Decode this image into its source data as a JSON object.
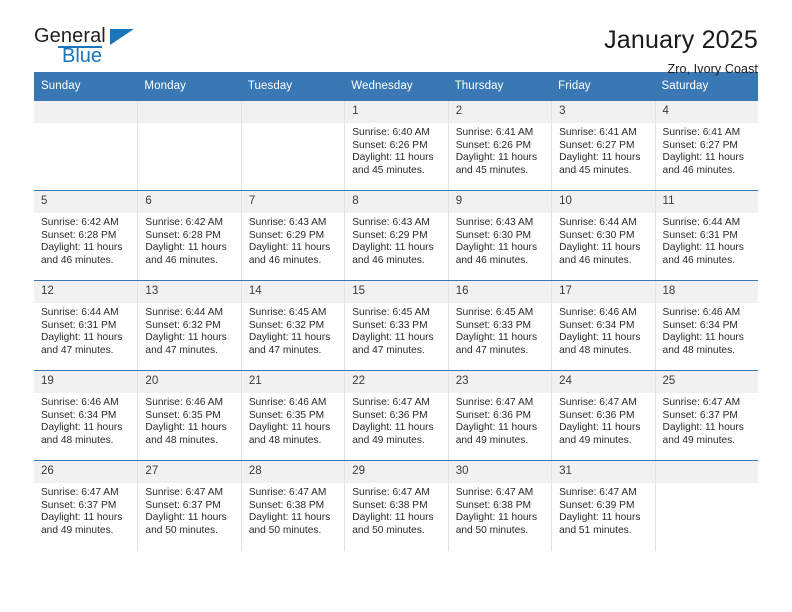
{
  "brand": {
    "name_top": "General",
    "name_bottom": "Blue",
    "accent_color": "#1b75bb"
  },
  "header": {
    "title": "January 2025",
    "subtitle": "Zro, Ivory Coast"
  },
  "theme": {
    "header_row_bg": "#3a78b5",
    "daynum_bg": "#f1f1f1",
    "cell_bg": "#ffffff",
    "text_color": "#2a2a2a"
  },
  "weekdays": [
    "Sunday",
    "Monday",
    "Tuesday",
    "Wednesday",
    "Thursday",
    "Friday",
    "Saturday"
  ],
  "labels": {
    "sunrise_prefix": "Sunrise:",
    "sunset_prefix": "Sunset:",
    "daylight_prefix": "Daylight:"
  },
  "weeks": [
    [
      {
        "day": "",
        "sunrise": "",
        "sunset": "",
        "daylight_1": "",
        "daylight_2": "",
        "empty": true
      },
      {
        "day": "",
        "sunrise": "",
        "sunset": "",
        "daylight_1": "",
        "daylight_2": "",
        "empty": true
      },
      {
        "day": "",
        "sunrise": "",
        "sunset": "",
        "daylight_1": "",
        "daylight_2": "",
        "empty": true
      },
      {
        "day": "1",
        "sunrise": "Sunrise: 6:40 AM",
        "sunset": "Sunset: 6:26 PM",
        "daylight_1": "Daylight: 11 hours",
        "daylight_2": "and 45 minutes."
      },
      {
        "day": "2",
        "sunrise": "Sunrise: 6:41 AM",
        "sunset": "Sunset: 6:26 PM",
        "daylight_1": "Daylight: 11 hours",
        "daylight_2": "and 45 minutes."
      },
      {
        "day": "3",
        "sunrise": "Sunrise: 6:41 AM",
        "sunset": "Sunset: 6:27 PM",
        "daylight_1": "Daylight: 11 hours",
        "daylight_2": "and 45 minutes."
      },
      {
        "day": "4",
        "sunrise": "Sunrise: 6:41 AM",
        "sunset": "Sunset: 6:27 PM",
        "daylight_1": "Daylight: 11 hours",
        "daylight_2": "and 46 minutes."
      }
    ],
    [
      {
        "day": "5",
        "sunrise": "Sunrise: 6:42 AM",
        "sunset": "Sunset: 6:28 PM",
        "daylight_1": "Daylight: 11 hours",
        "daylight_2": "and 46 minutes."
      },
      {
        "day": "6",
        "sunrise": "Sunrise: 6:42 AM",
        "sunset": "Sunset: 6:28 PM",
        "daylight_1": "Daylight: 11 hours",
        "daylight_2": "and 46 minutes."
      },
      {
        "day": "7",
        "sunrise": "Sunrise: 6:43 AM",
        "sunset": "Sunset: 6:29 PM",
        "daylight_1": "Daylight: 11 hours",
        "daylight_2": "and 46 minutes."
      },
      {
        "day": "8",
        "sunrise": "Sunrise: 6:43 AM",
        "sunset": "Sunset: 6:29 PM",
        "daylight_1": "Daylight: 11 hours",
        "daylight_2": "and 46 minutes."
      },
      {
        "day": "9",
        "sunrise": "Sunrise: 6:43 AM",
        "sunset": "Sunset: 6:30 PM",
        "daylight_1": "Daylight: 11 hours",
        "daylight_2": "and 46 minutes."
      },
      {
        "day": "10",
        "sunrise": "Sunrise: 6:44 AM",
        "sunset": "Sunset: 6:30 PM",
        "daylight_1": "Daylight: 11 hours",
        "daylight_2": "and 46 minutes."
      },
      {
        "day": "11",
        "sunrise": "Sunrise: 6:44 AM",
        "sunset": "Sunset: 6:31 PM",
        "daylight_1": "Daylight: 11 hours",
        "daylight_2": "and 46 minutes."
      }
    ],
    [
      {
        "day": "12",
        "sunrise": "Sunrise: 6:44 AM",
        "sunset": "Sunset: 6:31 PM",
        "daylight_1": "Daylight: 11 hours",
        "daylight_2": "and 47 minutes."
      },
      {
        "day": "13",
        "sunrise": "Sunrise: 6:44 AM",
        "sunset": "Sunset: 6:32 PM",
        "daylight_1": "Daylight: 11 hours",
        "daylight_2": "and 47 minutes."
      },
      {
        "day": "14",
        "sunrise": "Sunrise: 6:45 AM",
        "sunset": "Sunset: 6:32 PM",
        "daylight_1": "Daylight: 11 hours",
        "daylight_2": "and 47 minutes."
      },
      {
        "day": "15",
        "sunrise": "Sunrise: 6:45 AM",
        "sunset": "Sunset: 6:33 PM",
        "daylight_1": "Daylight: 11 hours",
        "daylight_2": "and 47 minutes."
      },
      {
        "day": "16",
        "sunrise": "Sunrise: 6:45 AM",
        "sunset": "Sunset: 6:33 PM",
        "daylight_1": "Daylight: 11 hours",
        "daylight_2": "and 47 minutes."
      },
      {
        "day": "17",
        "sunrise": "Sunrise: 6:46 AM",
        "sunset": "Sunset: 6:34 PM",
        "daylight_1": "Daylight: 11 hours",
        "daylight_2": "and 48 minutes."
      },
      {
        "day": "18",
        "sunrise": "Sunrise: 6:46 AM",
        "sunset": "Sunset: 6:34 PM",
        "daylight_1": "Daylight: 11 hours",
        "daylight_2": "and 48 minutes."
      }
    ],
    [
      {
        "day": "19",
        "sunrise": "Sunrise: 6:46 AM",
        "sunset": "Sunset: 6:34 PM",
        "daylight_1": "Daylight: 11 hours",
        "daylight_2": "and 48 minutes."
      },
      {
        "day": "20",
        "sunrise": "Sunrise: 6:46 AM",
        "sunset": "Sunset: 6:35 PM",
        "daylight_1": "Daylight: 11 hours",
        "daylight_2": "and 48 minutes."
      },
      {
        "day": "21",
        "sunrise": "Sunrise: 6:46 AM",
        "sunset": "Sunset: 6:35 PM",
        "daylight_1": "Daylight: 11 hours",
        "daylight_2": "and 48 minutes."
      },
      {
        "day": "22",
        "sunrise": "Sunrise: 6:47 AM",
        "sunset": "Sunset: 6:36 PM",
        "daylight_1": "Daylight: 11 hours",
        "daylight_2": "and 49 minutes."
      },
      {
        "day": "23",
        "sunrise": "Sunrise: 6:47 AM",
        "sunset": "Sunset: 6:36 PM",
        "daylight_1": "Daylight: 11 hours",
        "daylight_2": "and 49 minutes."
      },
      {
        "day": "24",
        "sunrise": "Sunrise: 6:47 AM",
        "sunset": "Sunset: 6:36 PM",
        "daylight_1": "Daylight: 11 hours",
        "daylight_2": "and 49 minutes."
      },
      {
        "day": "25",
        "sunrise": "Sunrise: 6:47 AM",
        "sunset": "Sunset: 6:37 PM",
        "daylight_1": "Daylight: 11 hours",
        "daylight_2": "and 49 minutes."
      }
    ],
    [
      {
        "day": "26",
        "sunrise": "Sunrise: 6:47 AM",
        "sunset": "Sunset: 6:37 PM",
        "daylight_1": "Daylight: 11 hours",
        "daylight_2": "and 49 minutes."
      },
      {
        "day": "27",
        "sunrise": "Sunrise: 6:47 AM",
        "sunset": "Sunset: 6:37 PM",
        "daylight_1": "Daylight: 11 hours",
        "daylight_2": "and 50 minutes."
      },
      {
        "day": "28",
        "sunrise": "Sunrise: 6:47 AM",
        "sunset": "Sunset: 6:38 PM",
        "daylight_1": "Daylight: 11 hours",
        "daylight_2": "and 50 minutes."
      },
      {
        "day": "29",
        "sunrise": "Sunrise: 6:47 AM",
        "sunset": "Sunset: 6:38 PM",
        "daylight_1": "Daylight: 11 hours",
        "daylight_2": "and 50 minutes."
      },
      {
        "day": "30",
        "sunrise": "Sunrise: 6:47 AM",
        "sunset": "Sunset: 6:38 PM",
        "daylight_1": "Daylight: 11 hours",
        "daylight_2": "and 50 minutes."
      },
      {
        "day": "31",
        "sunrise": "Sunrise: 6:47 AM",
        "sunset": "Sunset: 6:39 PM",
        "daylight_1": "Daylight: 11 hours",
        "daylight_2": "and 51 minutes."
      },
      {
        "day": "",
        "sunrise": "",
        "sunset": "",
        "daylight_1": "",
        "daylight_2": "",
        "empty": true
      }
    ]
  ]
}
